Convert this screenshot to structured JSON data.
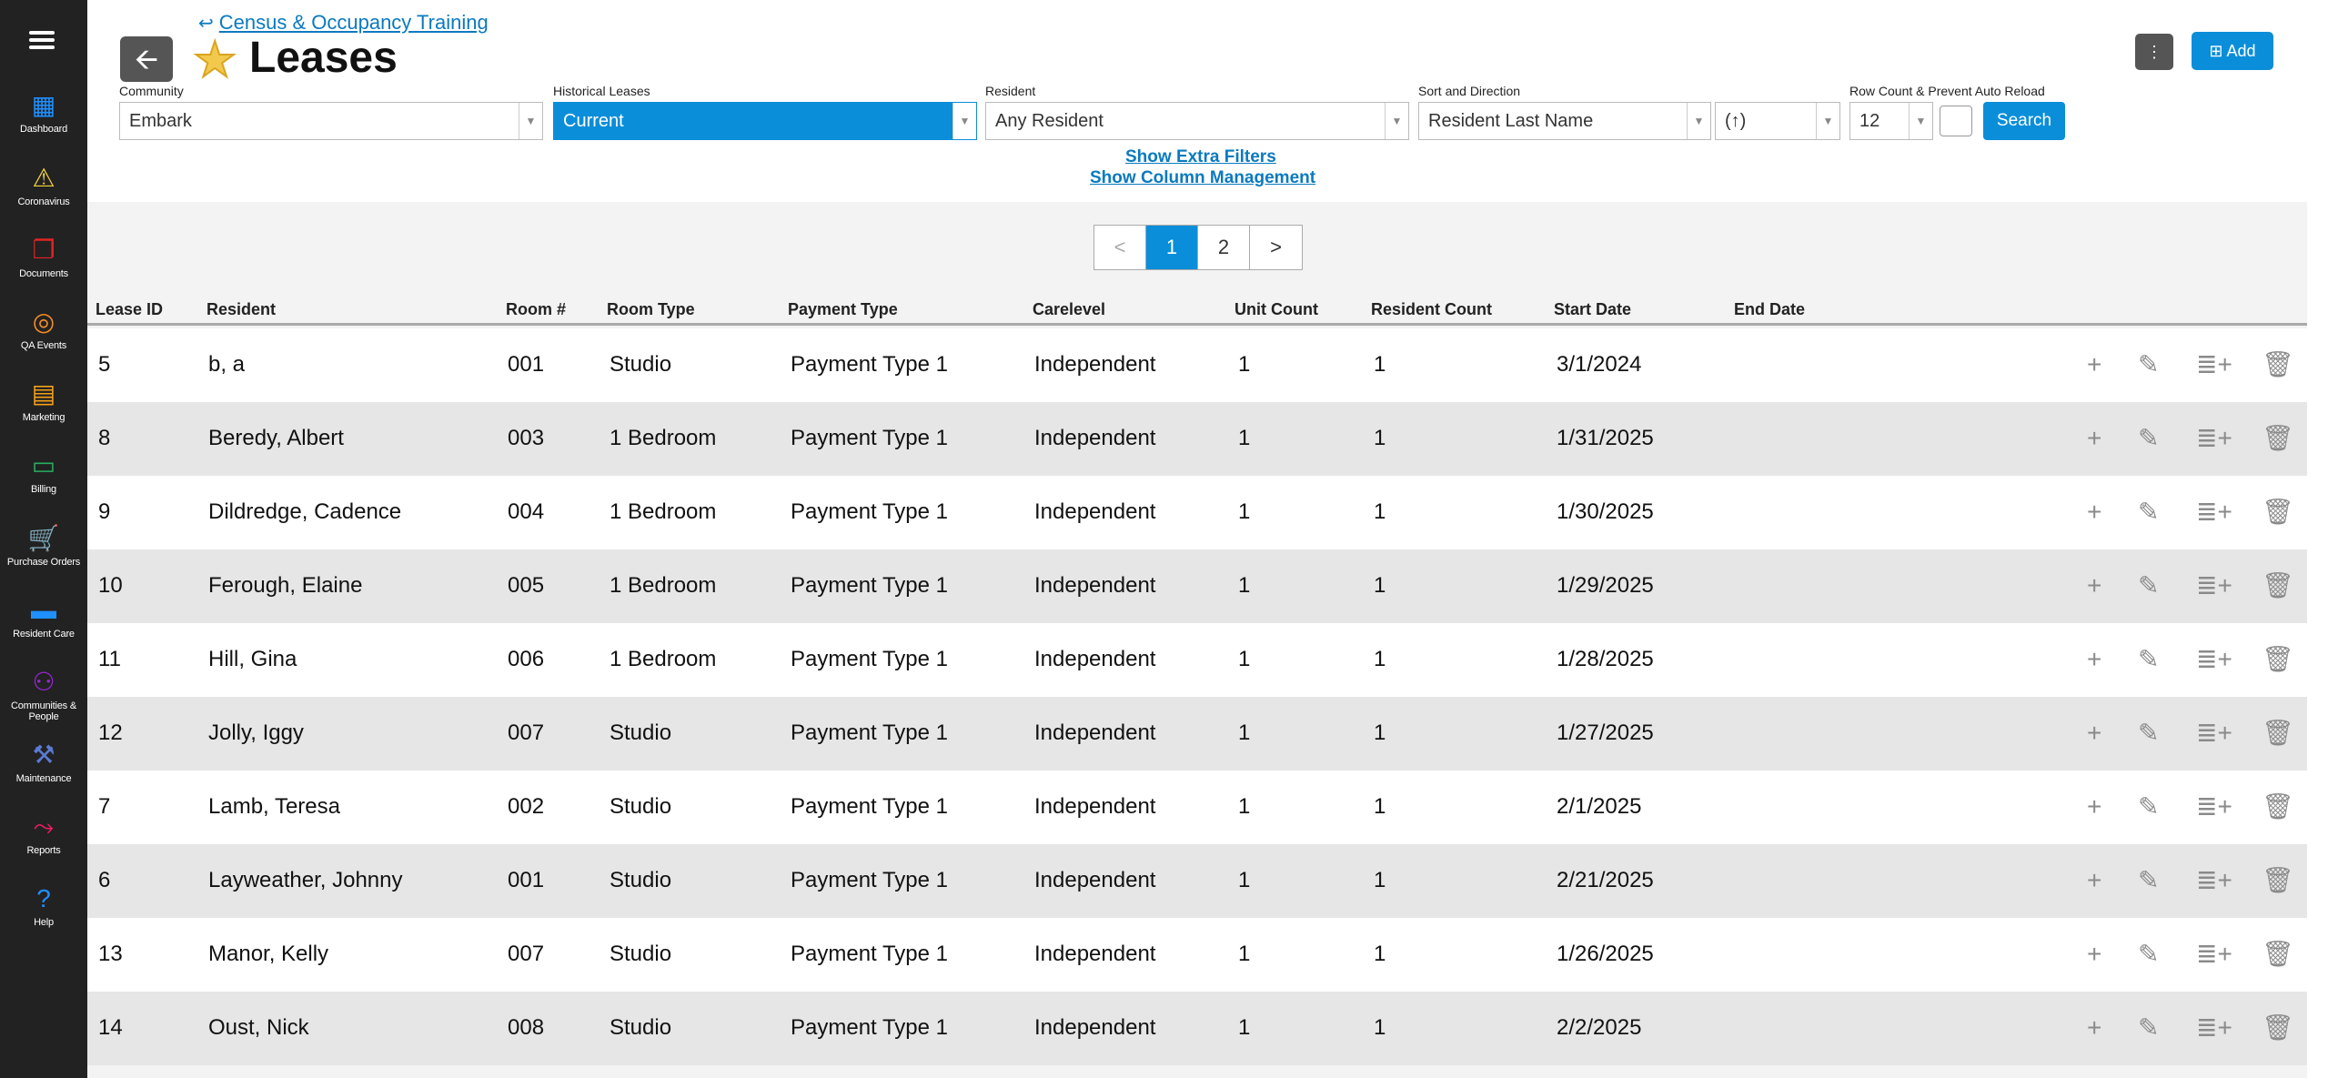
{
  "sidebar": {
    "items": [
      {
        "label": "Dashboard",
        "icon": "dashboard-icon",
        "color": "#1e90ff"
      },
      {
        "label": "Coronavirus",
        "icon": "warning-icon",
        "color": "#f4d03f"
      },
      {
        "label": "Documents",
        "icon": "documents-icon",
        "color": "#e02424"
      },
      {
        "label": "QA Events",
        "icon": "lifebuoy-icon",
        "color": "#f28c28"
      },
      {
        "label": "Marketing",
        "icon": "briefcase-icon",
        "color": "#f2a01b"
      },
      {
        "label": "Billing",
        "icon": "credit-card-icon",
        "color": "#27ae60"
      },
      {
        "label": "Purchase Orders",
        "icon": "cart-icon",
        "color": "#2ecc71"
      },
      {
        "label": "Resident Care",
        "icon": "folder-icon",
        "color": "#1e90ff"
      },
      {
        "label": "Communities & People",
        "icon": "people-icon",
        "color": "#9b27d9"
      },
      {
        "label": "Maintenance",
        "icon": "tools-icon",
        "color": "#5b7bd5"
      },
      {
        "label": "Reports",
        "icon": "chart-line-icon",
        "color": "#e91e63"
      },
      {
        "label": "Help",
        "icon": "question-icon",
        "color": "#1e90ff"
      }
    ]
  },
  "header": {
    "breadcrumb": "Census & Occupancy Training",
    "title": "Leases",
    "add_label": "Add",
    "kebab_label": "⋮"
  },
  "filters": {
    "community_label": "Community",
    "community_value": "Embark",
    "historical_label": "Historical Leases",
    "historical_value": "Current",
    "resident_label": "Resident",
    "resident_value": "Any Resident",
    "sort_label": "Sort and Direction",
    "sort_value": "Resident Last Name",
    "direction_value": "(↑)",
    "rowcount_label": "Row Count & Prevent Auto Reload",
    "rowcount_value": "12",
    "search_label": "Search",
    "extra_filters_link": "Show Extra Filters",
    "column_mgmt_link": "Show Column Management"
  },
  "pagination": {
    "prev": "<",
    "pages": [
      "1",
      "2"
    ],
    "next": ">",
    "active": "1"
  },
  "table": {
    "columns": [
      "Lease ID",
      "Resident",
      "Room #",
      "Room Type",
      "Payment Type",
      "Carelevel",
      "Unit Count",
      "Resident Count",
      "Start Date",
      "End Date"
    ],
    "rows": [
      [
        "5",
        "b, a",
        "001",
        "Studio",
        "Payment Type 1",
        "Independent",
        "1",
        "1",
        "3/1/2024",
        ""
      ],
      [
        "8",
        "Beredy, Albert",
        "003",
        "1 Bedroom",
        "Payment Type 1",
        "Independent",
        "1",
        "1",
        "1/31/2025",
        ""
      ],
      [
        "9",
        "Dildredge, Cadence",
        "004",
        "1 Bedroom",
        "Payment Type 1",
        "Independent",
        "1",
        "1",
        "1/30/2025",
        ""
      ],
      [
        "10",
        "Ferough, Elaine",
        "005",
        "1 Bedroom",
        "Payment Type 1",
        "Independent",
        "1",
        "1",
        "1/29/2025",
        ""
      ],
      [
        "11",
        "Hill, Gina",
        "006",
        "1 Bedroom",
        "Payment Type 1",
        "Independent",
        "1",
        "1",
        "1/28/2025",
        ""
      ],
      [
        "12",
        "Jolly, Iggy",
        "007",
        "Studio",
        "Payment Type 1",
        "Independent",
        "1",
        "1",
        "1/27/2025",
        ""
      ],
      [
        "7",
        "Lamb, Teresa",
        "002",
        "Studio",
        "Payment Type 1",
        "Independent",
        "1",
        "1",
        "2/1/2025",
        ""
      ],
      [
        "6",
        "Layweather, Johnny",
        "001",
        "Studio",
        "Payment Type 1",
        "Independent",
        "1",
        "1",
        "2/21/2025",
        ""
      ],
      [
        "13",
        "Manor, Kelly",
        "007",
        "Studio",
        "Payment Type 1",
        "Independent",
        "1",
        "1",
        "1/26/2025",
        ""
      ],
      [
        "14",
        "Oust, Nick",
        "008",
        "Studio",
        "Payment Type 1",
        "Independent",
        "1",
        "1",
        "2/2/2025",
        ""
      ]
    ],
    "row_actions": [
      "plus-icon",
      "pencil-icon",
      "list-add-icon",
      "trash-icon"
    ]
  }
}
